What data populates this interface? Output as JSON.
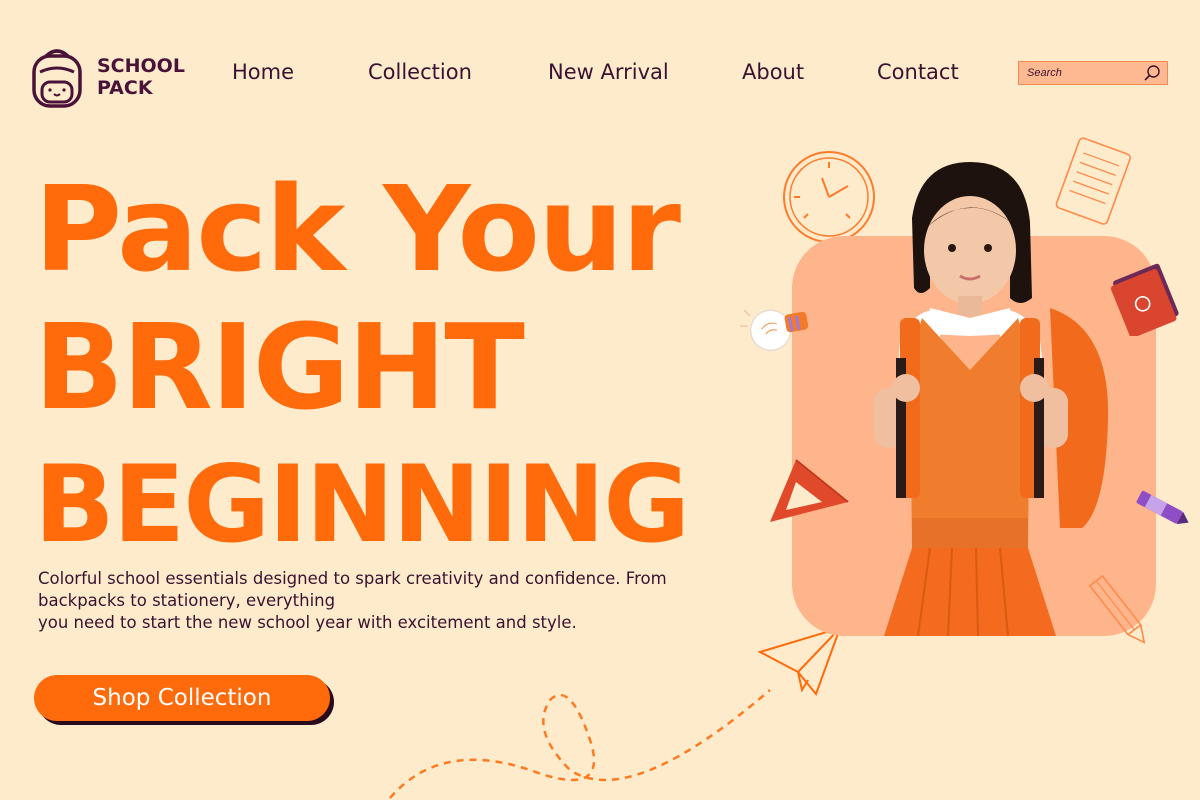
{
  "brand": {
    "line1": "SCHOOL",
    "line2": "PACK"
  },
  "nav": {
    "home": "Home",
    "collection": "Collection",
    "new_arrival": "New Arrival",
    "about": "About",
    "contact": "Contact"
  },
  "search": {
    "placeholder": "Search"
  },
  "hero": {
    "title_line1": "Pack Your",
    "title_line2": "BRIGHT",
    "title_line3": "BEGINNING",
    "desc_line1": "Colorful school essentials designed to spark creativity and confidence. From",
    "desc_line2": "backpacks to stationery, everything",
    "desc_line3": "you need to start the new school year with excitement and style.",
    "cta_label": "Shop Collection"
  },
  "colors": {
    "background": "#fdebcc",
    "accent": "#ff6a0a",
    "brand_dark": "#4a1238",
    "photo_panel": "#ffb58b"
  }
}
